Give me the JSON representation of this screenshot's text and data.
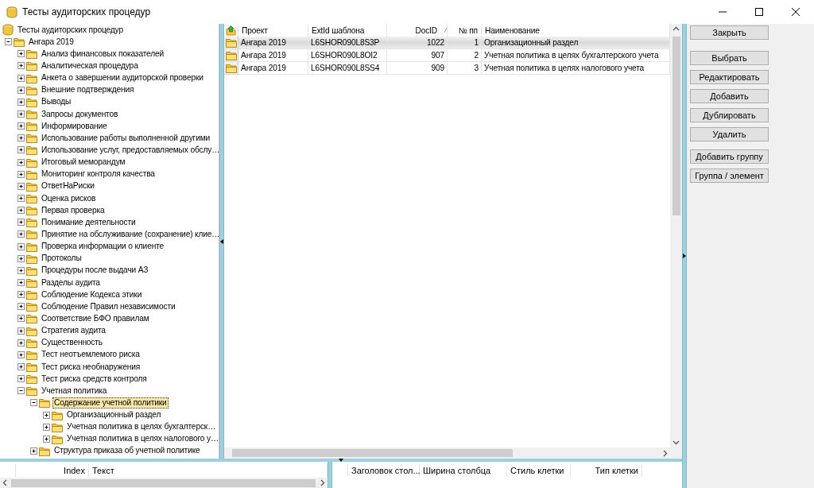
{
  "window": {
    "title": "Тесты аудиторских процедур"
  },
  "tree": {
    "root": {
      "label": "Тесты аудиторских процедур",
      "selected": false,
      "children": [
        {
          "label": "Ангара 2019",
          "expanded": true,
          "selected": false,
          "children": [
            {
              "label": "Анализ финансовых показателей",
              "expanded": false,
              "selected": false
            },
            {
              "label": "Аналитическая процедура",
              "expanded": false,
              "selected": false
            },
            {
              "label": "Анкета о завершении аудиторской проверки",
              "expanded": false,
              "selected": false
            },
            {
              "label": "Внешние подтверждения",
              "expanded": false,
              "selected": false
            },
            {
              "label": "Выводы",
              "expanded": false,
              "selected": false
            },
            {
              "label": "Запросы документов",
              "expanded": false,
              "selected": false
            },
            {
              "label": "Информирование",
              "expanded": false,
              "selected": false
            },
            {
              "label": "Использование работы выполненной другими",
              "expanded": false,
              "selected": false
            },
            {
              "label": "Использование услуг, предоставляемых обслу…",
              "expanded": false,
              "selected": false
            },
            {
              "label": "Итоговый меморандум",
              "expanded": false,
              "selected": false
            },
            {
              "label": "Мониторинг контроля качества",
              "expanded": false,
              "selected": false
            },
            {
              "label": "ОтветНаРиски",
              "expanded": false,
              "selected": false
            },
            {
              "label": "Оценка рисков",
              "expanded": false,
              "selected": false
            },
            {
              "label": "Первая проверка",
              "expanded": false,
              "selected": false
            },
            {
              "label": "Понимание деятельности",
              "expanded": false,
              "selected": false
            },
            {
              "label": "Принятие на обслуживание (сохранение) клие…",
              "expanded": false,
              "selected": false
            },
            {
              "label": "Проверка информации о клиенте",
              "expanded": false,
              "selected": false
            },
            {
              "label": "Протоколы",
              "expanded": false,
              "selected": false
            },
            {
              "label": "Процедуры после выдачи АЗ",
              "expanded": false,
              "selected": false
            },
            {
              "label": "Разделы аудита",
              "expanded": false,
              "selected": false
            },
            {
              "label": "Соблюдение Кодекса этики",
              "expanded": false,
              "selected": false
            },
            {
              "label": "Соблюдение Правил независимости",
              "expanded": false,
              "selected": false
            },
            {
              "label": "Соответствие БФО правилам",
              "expanded": false,
              "selected": false
            },
            {
              "label": "Стратегия аудита",
              "expanded": false,
              "selected": false
            },
            {
              "label": "Существенность",
              "expanded": false,
              "selected": false
            },
            {
              "label": "Тест неотъемлемого риска",
              "expanded": false,
              "selected": false
            },
            {
              "label": "Тест риска необнаружения",
              "expanded": false,
              "selected": false
            },
            {
              "label": "Тест риска средств контроля",
              "expanded": false,
              "selected": false
            },
            {
              "label": "Учетная политика",
              "expanded": true,
              "selected": false,
              "children": [
                {
                  "label": "Содержание учетной политики",
                  "expanded": true,
                  "selected": true,
                  "children": [
                    {
                      "label": "Организационный раздел",
                      "expanded": false,
                      "selected": false
                    },
                    {
                      "label": "Учетная политика в целях бухгалтерск…",
                      "expanded": false,
                      "selected": false
                    },
                    {
                      "label": "Учетная политика в целях налогового у…",
                      "expanded": false,
                      "selected": false
                    }
                  ]
                },
                {
                  "label": "Структура приказа об учетной политике",
                  "expanded": false,
                  "selected": false
                }
              ]
            }
          ]
        }
      ]
    }
  },
  "grid": {
    "columns": [
      "Проект",
      "ExtId шаблона",
      "DocID",
      "№ пп",
      "Наименование"
    ],
    "rows": [
      {
        "selected": true,
        "cells": [
          "Ангара 2019",
          "L6SHOR090L8S3P",
          "1022",
          "1",
          "Организационный раздел"
        ]
      },
      {
        "selected": false,
        "cells": [
          "Ангара 2019",
          "L6SHOR090L8OI2",
          "907",
          "2",
          "Учетная политика в целях бухгалтерского учета"
        ]
      },
      {
        "selected": false,
        "cells": [
          "Ангара 2019",
          "L6SHOR090L8SS4",
          "909",
          "3",
          "Учетная политика в целях налогового учета"
        ]
      }
    ]
  },
  "button_groups": [
    [
      "Закрыть"
    ],
    [
      "Выбрать",
      "Редактировать",
      "Добавить",
      "Дублировать",
      "Удалить"
    ],
    [
      "Добавить группу",
      "Группа / элемент"
    ]
  ],
  "text_grid": {
    "columns": [
      "Index",
      "Текст"
    ]
  },
  "columns_grid": {
    "columns": [
      "Заголовок стол...",
      "Ширина столбца",
      "Стиль клетки",
      "Тип клетки"
    ]
  }
}
